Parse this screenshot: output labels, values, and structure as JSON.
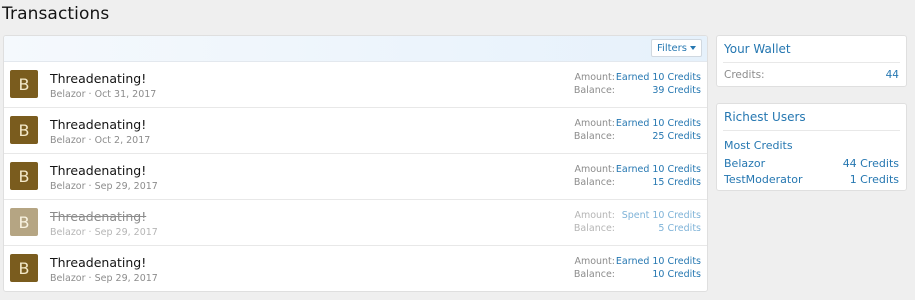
{
  "page": {
    "title": "Transactions"
  },
  "filters": {
    "label": "Filters"
  },
  "transactions": [
    {
      "avatar_letter": "B",
      "title": "Threadenating!",
      "user": "Belazor",
      "date": "Oct 31, 2017",
      "amount_label": "Amount:",
      "amount": "Earned 10 Credits",
      "balance_label": "Balance:",
      "balance": "39 Credits",
      "reverted": false
    },
    {
      "avatar_letter": "B",
      "title": "Threadenating!",
      "user": "Belazor",
      "date": "Oct 2, 2017",
      "amount_label": "Amount:",
      "amount": "Earned 10 Credits",
      "balance_label": "Balance:",
      "balance": "25 Credits",
      "reverted": false
    },
    {
      "avatar_letter": "B",
      "title": "Threadenating!",
      "user": "Belazor",
      "date": "Sep 29, 2017",
      "amount_label": "Amount:",
      "amount": "Earned 10 Credits",
      "balance_label": "Balance:",
      "balance": "15 Credits",
      "reverted": false
    },
    {
      "avatar_letter": "B",
      "title": "Threadenating!",
      "user": "Belazor",
      "date": "Sep 29, 2017",
      "amount_label": "Amount:",
      "amount": "Spent 10 Credits",
      "balance_label": "Balance:",
      "balance": "5 Credits",
      "reverted": true
    },
    {
      "avatar_letter": "B",
      "title": "Threadenating!",
      "user": "Belazor",
      "date": "Sep 29, 2017",
      "amount_label": "Amount:",
      "amount": "Earned 10 Credits",
      "balance_label": "Balance:",
      "balance": "10 Credits",
      "reverted": false
    }
  ],
  "wallet": {
    "title": "Your Wallet",
    "credits_label": "Credits:",
    "credits_value": "44"
  },
  "richest": {
    "title": "Richest Users",
    "subtitle": "Most Credits",
    "users": [
      {
        "name": "Belazor",
        "credits": "44 Credits"
      },
      {
        "name": "TestModerator",
        "credits": "1 Credits"
      }
    ]
  },
  "colors": {
    "link": "#2577b1",
    "avatar_bg": "#7a5c1e",
    "muted": "#8c8c8c"
  },
  "icons": {
    "filters_caret": "caret-down-icon"
  }
}
